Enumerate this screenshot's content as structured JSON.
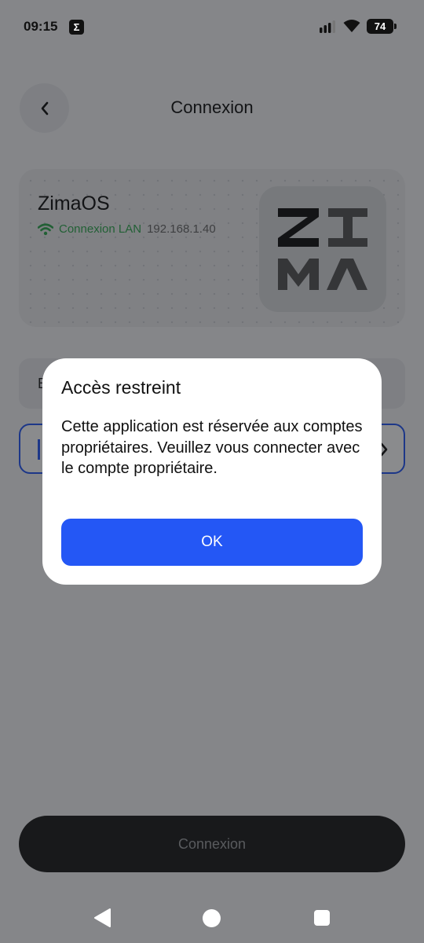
{
  "status_bar": {
    "time": "09:15",
    "app_icon": "sigma-icon",
    "battery": "74"
  },
  "header": {
    "title": "Connexion",
    "back_icon": "chevron-left-icon"
  },
  "device_card": {
    "name": "ZimaOS",
    "connection_label": "Connexion LAN",
    "ip": "192.168.1.40",
    "logo": "zima-logo"
  },
  "form": {
    "input_prefix": "E"
  },
  "connect_button": {
    "label": "Connexion"
  },
  "dialog": {
    "title": "Accès restreint",
    "message": "Cette application est réservée aux comptes propriétaires. Veuillez vous connecter avec le compte propriétaire.",
    "ok_label": "OK"
  },
  "colors": {
    "accent": "#2457f5",
    "lan_green": "#2fa84f",
    "button_dark": "#1a1a1a"
  }
}
